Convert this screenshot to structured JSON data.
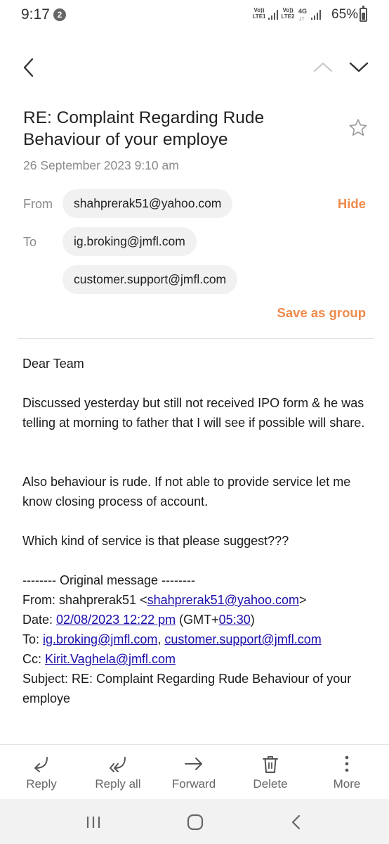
{
  "status_bar": {
    "time": "9:17",
    "notification_count": "2",
    "sim1_label": "Vo)) LTE1",
    "sim2_label": "Vo)) LTE2",
    "sim2_network": "4G",
    "battery": "65%"
  },
  "email": {
    "subject": "RE: Complaint  Regarding Rude Behaviour of your employe",
    "date": "26 September 2023  9:10 am",
    "from_label": "From",
    "from": "shahprerak51@yahoo.com",
    "hide_label": "Hide",
    "to_label": "To",
    "to": [
      "ig.broking@jmfl.com",
      "customer.support@jmfl.com"
    ],
    "save_as_group_label": "Save as group",
    "body": {
      "greeting": "Dear Team",
      "para1": "Discussed yesterday but still not received IPO form & he was telling at morning to father that I will see if possible will share.",
      "para2": "Also behaviour is rude. If not able to provide service let me know closing process of account.",
      "para3": "Which kind of service is that please suggest???",
      "original": {
        "header": "-------- Original message --------",
        "from_prefix": "From: shahprerak51 <",
        "from_link": "shahprerak51@yahoo.com",
        "from_suffix": ">",
        "date_prefix": "Date: ",
        "date_link": "02/08/2023 12:22 pm",
        "date_mid": " (GMT+",
        "tz_link": "05:30",
        "date_suffix": ")",
        "to_prefix": "To: ",
        "to_link1": "ig.broking@jmfl.com",
        "to_sep": ", ",
        "to_link2": "customer.support@jmfl.com",
        "cc_prefix": "Cc: ",
        "cc_link": "Kirit.Vaghela@jmfl.com",
        "subject_line": "Subject: RE: Complaint Regarding Rude Behaviour of your employe"
      }
    }
  },
  "actions": [
    {
      "label": "Reply",
      "icon": "reply-icon"
    },
    {
      "label": "Reply all",
      "icon": "reply-all-icon"
    },
    {
      "label": "Forward",
      "icon": "forward-icon"
    },
    {
      "label": "Delete",
      "icon": "trash-icon"
    },
    {
      "label": "More",
      "icon": "more-vertical-icon"
    }
  ],
  "colors": {
    "accent": "#f08a4b",
    "link": "#1a0dab"
  }
}
